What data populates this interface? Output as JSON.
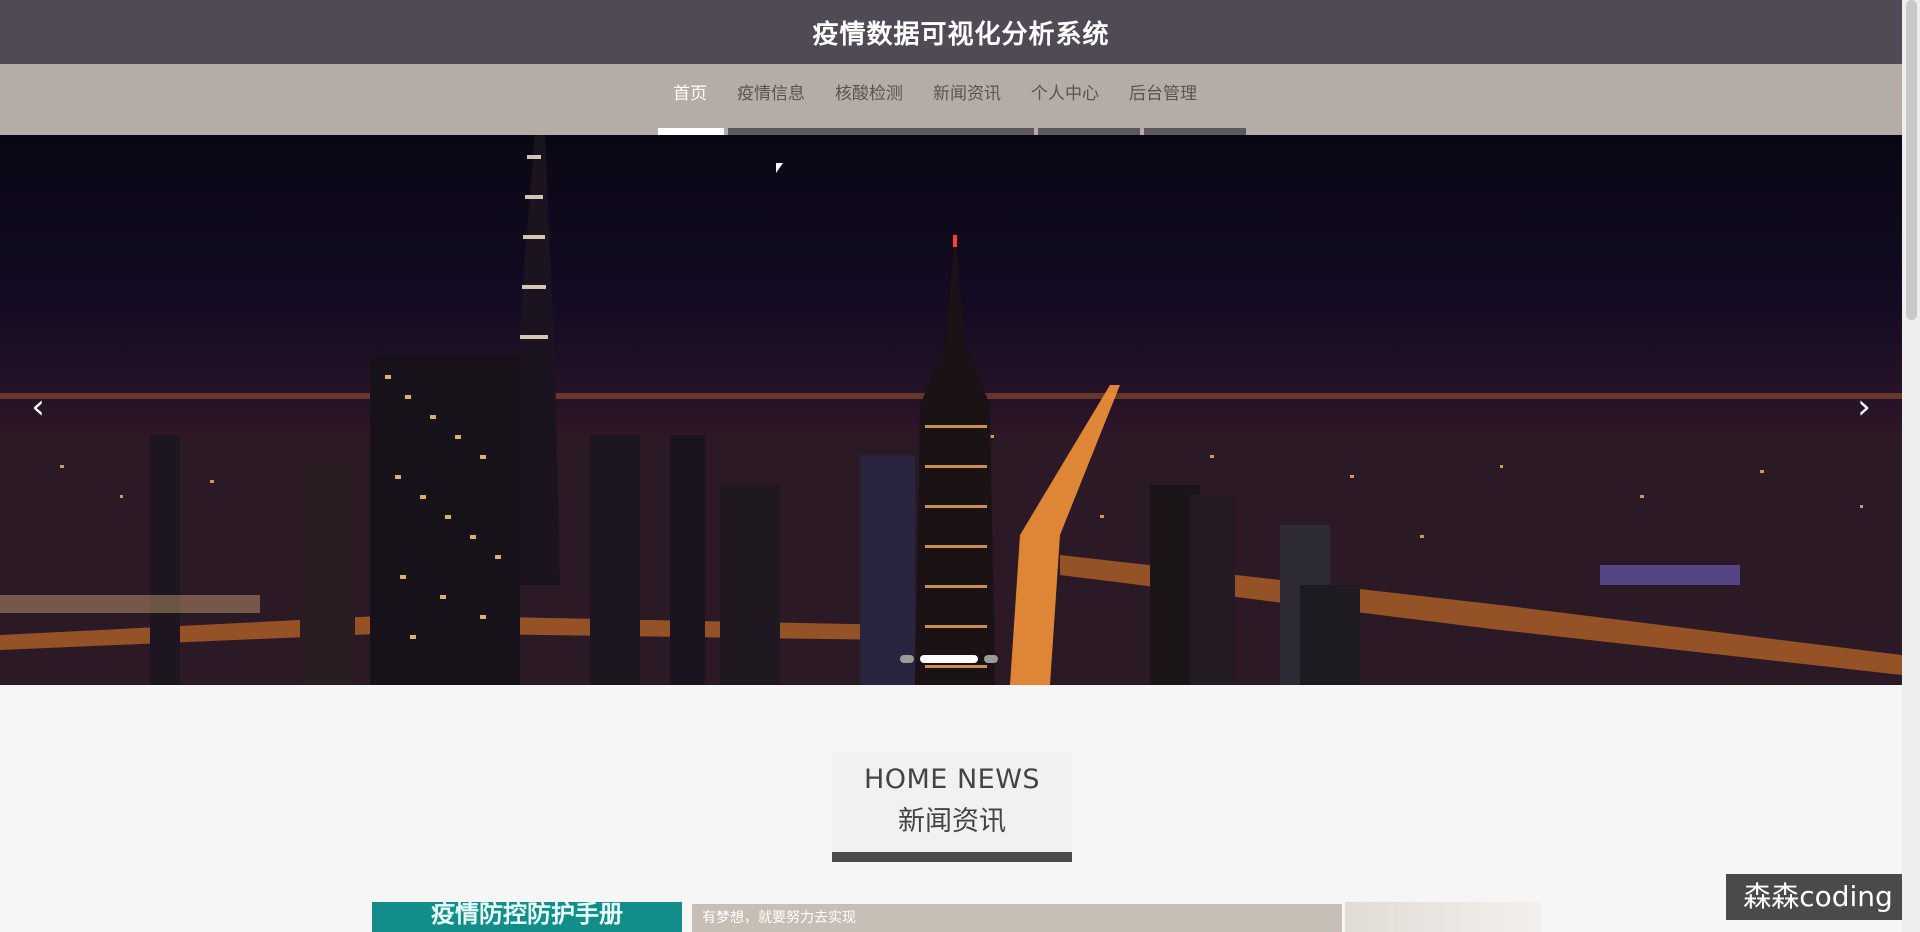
{
  "header": {
    "title": "疫情数据可视化分析系统"
  },
  "nav": {
    "items": [
      {
        "label": "首页",
        "active": true
      },
      {
        "label": "疫情信息",
        "active": false
      },
      {
        "label": "核酸检测",
        "active": false
      },
      {
        "label": "新闻资讯",
        "active": false
      },
      {
        "label": "个人中心",
        "active": false
      },
      {
        "label": "后台管理",
        "active": false
      }
    ]
  },
  "carousel": {
    "prev_icon": "chevron-left-icon",
    "next_icon": "chevron-right-icon",
    "prev_glyph": "‹",
    "next_glyph": "›",
    "slide_count": 3,
    "active_slide": 2
  },
  "news_section": {
    "title_en": "HOME NEWS",
    "title_zh": "新闻资讯",
    "first_item": {
      "thumb_text": "疫情防控防护手册",
      "text": "有梦想，就要努力去实现"
    }
  },
  "watermark": {
    "text": "森森coding"
  },
  "colors": {
    "topbar": "#4f4a55",
    "navbar": "#b5aca6",
    "accent": "#138d89"
  }
}
